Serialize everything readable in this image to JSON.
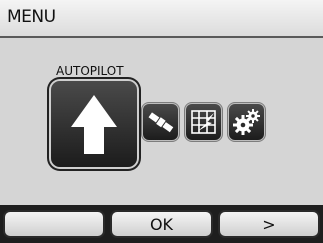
{
  "header": {
    "title": "MENU"
  },
  "main": {
    "selected_label": "AUTOPILOT",
    "options": [
      {
        "icon": "arrow-up-icon"
      },
      {
        "icon": "satellite-icon"
      },
      {
        "icon": "map-grid-icon"
      },
      {
        "icon": "gears-icon"
      }
    ]
  },
  "softkeys": {
    "left": "",
    "center": "OK",
    "right": ">"
  }
}
